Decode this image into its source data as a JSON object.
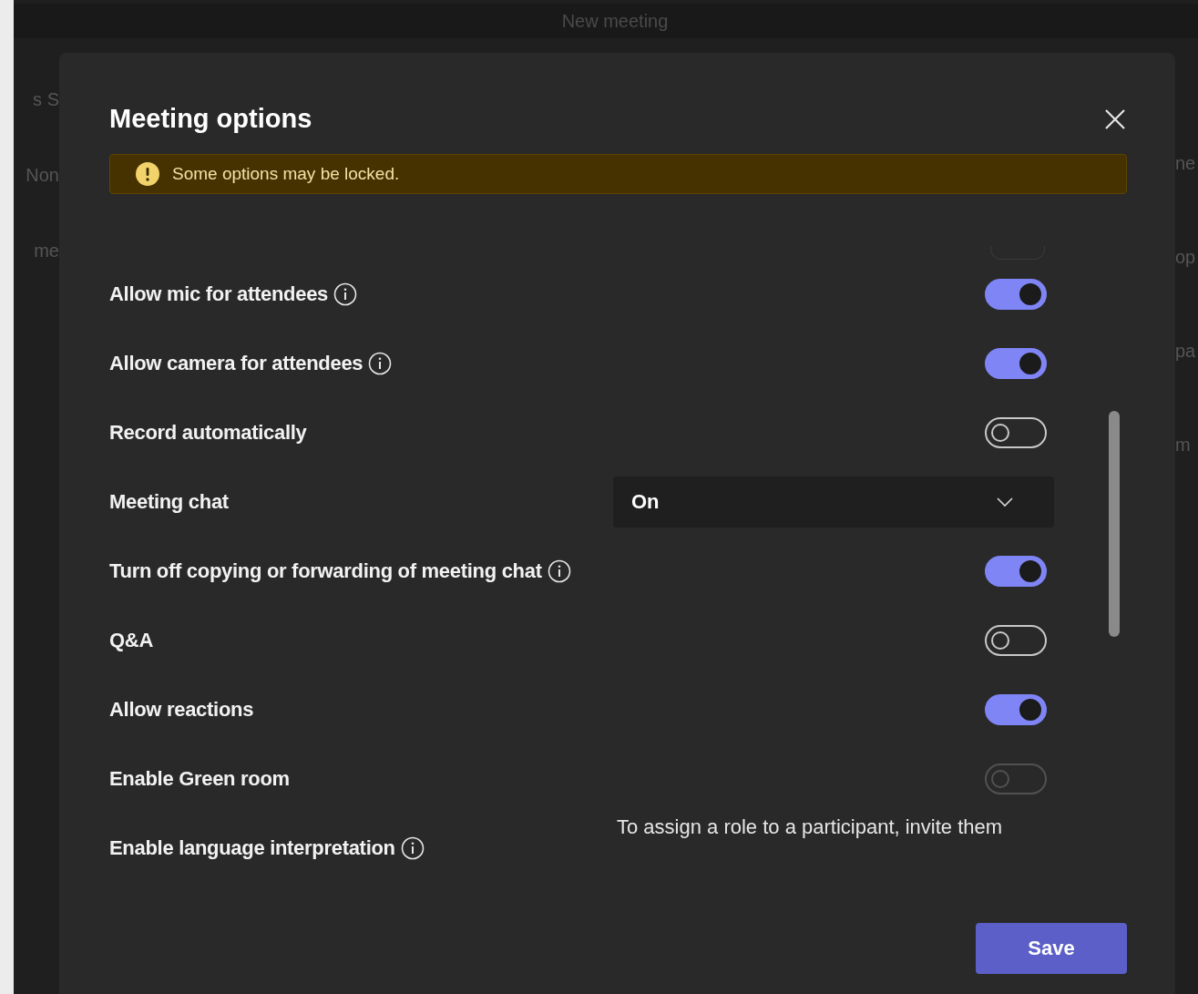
{
  "window": {
    "title": "New meeting"
  },
  "background": {
    "left_fragments": [
      "s  S",
      "Non",
      "me"
    ],
    "right_fragments": [
      "ne",
      "op",
      "pa",
      "m"
    ]
  },
  "dialog": {
    "title": "Meeting options",
    "banner": "Some options may be locked.",
    "options": [
      {
        "kind": "toggle",
        "label": "Allow mic for attendees",
        "info": true,
        "on": true,
        "disabled": false
      },
      {
        "kind": "toggle",
        "label": "Allow camera for attendees",
        "info": true,
        "on": true,
        "disabled": false
      },
      {
        "kind": "toggle",
        "label": "Record automatically",
        "info": false,
        "on": false,
        "disabled": false
      },
      {
        "kind": "dropdown",
        "label": "Meeting chat",
        "info": false,
        "value": "On"
      },
      {
        "kind": "toggle",
        "label": "Turn off copying or forwarding of meeting chat",
        "info": true,
        "on": true,
        "disabled": false
      },
      {
        "kind": "toggle",
        "label": "Q&A",
        "info": false,
        "on": false,
        "disabled": false
      },
      {
        "kind": "toggle",
        "label": "Allow reactions",
        "info": false,
        "on": true,
        "disabled": false
      },
      {
        "kind": "toggle",
        "label": "Enable Green room",
        "info": false,
        "on": false,
        "disabled": true
      },
      {
        "kind": "note",
        "label": "Enable language interpretation",
        "info": true,
        "note": "To assign a role to a participant, invite them"
      }
    ],
    "save": "Save"
  }
}
